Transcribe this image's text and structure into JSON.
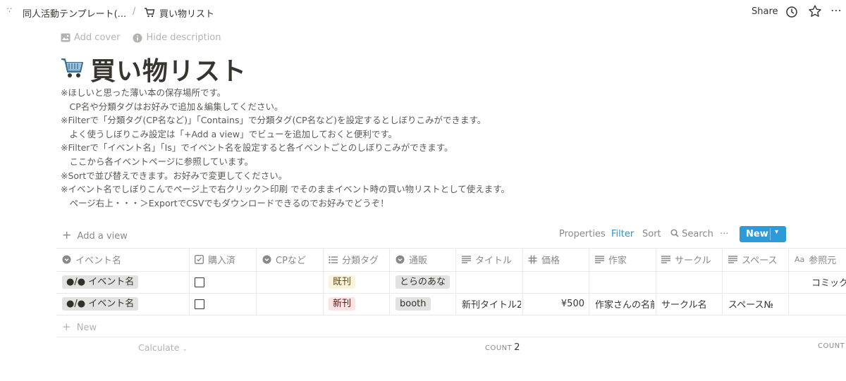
{
  "topbar": {
    "workspace_crumb": "同人活動テンプレート(...",
    "separator": "/",
    "page_crumb": "買い物リスト",
    "share_label": "Share"
  },
  "page": {
    "add_cover": "Add cover",
    "hide_description": "Hide description",
    "title": "買い物リスト",
    "description": [
      "※ほしいと思った薄い本の保存場所です。",
      "　CP名や分類タグはお好みで追加＆編集してください。",
      "※Filterで「分類タグ(CP名など)」「Contains」で分類タグ(CP名など)を設定するとしぼりこみができます。",
      "　よく使うしぼりこみ設定は「+Add a view」でビューを追加しておくと便利です。",
      "※Filterで「イベント名」「Is」でイベント名を設定すると各イベントごとのしぼりこみができます。",
      "　ここから各イベントページに参照しています。",
      "※Sortで並び替えできます。お好みで変更してください。",
      "※イベント名でしぼりこんでページ上で右クリック＞印刷 でそのままイベント時の買い物リストとして使えます。",
      "　ページ右上・・・＞ExportでCSVでもダウンロードできるのでお好みでどうぞ！"
    ]
  },
  "view_toolbar": {
    "add_view": "Add a view",
    "properties": "Properties",
    "filter": "Filter",
    "sort": "Sort",
    "search": "Search",
    "more": "···",
    "new": "New"
  },
  "table": {
    "columns": [
      {
        "icon": "select-icon",
        "label": "イベント名"
      },
      {
        "icon": "checkbox-icon",
        "label": "購入済"
      },
      {
        "icon": "select-icon",
        "label": "CPなど"
      },
      {
        "icon": "multiselect-icon",
        "label": "分類タグ"
      },
      {
        "icon": "select-icon",
        "label": "通販"
      },
      {
        "icon": "text-icon",
        "label": "タイトル"
      },
      {
        "icon": "number-icon",
        "label": "価格"
      },
      {
        "icon": "text-icon",
        "label": "作家"
      },
      {
        "icon": "text-icon",
        "label": "サークル"
      },
      {
        "icon": "text-icon",
        "label": "スペース"
      },
      {
        "icon": "title-icon",
        "label": "参照元"
      }
    ],
    "rows": [
      {
        "event": "●/● イベント名",
        "purchased": false,
        "cp": "",
        "tag": "既刊",
        "tag_color": "#fbf3db",
        "shop": "とらのあな",
        "title": "",
        "price": "",
        "author": "",
        "circle": "",
        "space": "",
        "ref": "コミック"
      },
      {
        "event": "●/● イベント名",
        "purchased": false,
        "cp": "",
        "tag": "新刊",
        "tag_color": "#fbe4e4",
        "shop": "booth",
        "title": "新刊タイトル2",
        "price": "¥500",
        "author": "作家さんの名前",
        "circle": "サークル名",
        "space": "スペース№",
        "ref": ""
      }
    ],
    "new_row": "New",
    "calculate": "Calculate",
    "count_label": "COUNT",
    "count_value": "2",
    "count_label_right": "COUNT"
  },
  "colors": {
    "accent": "#2e9ad7",
    "filter_active": "#2f8ecd",
    "text": "#37352f",
    "muted": "#8a8985"
  }
}
